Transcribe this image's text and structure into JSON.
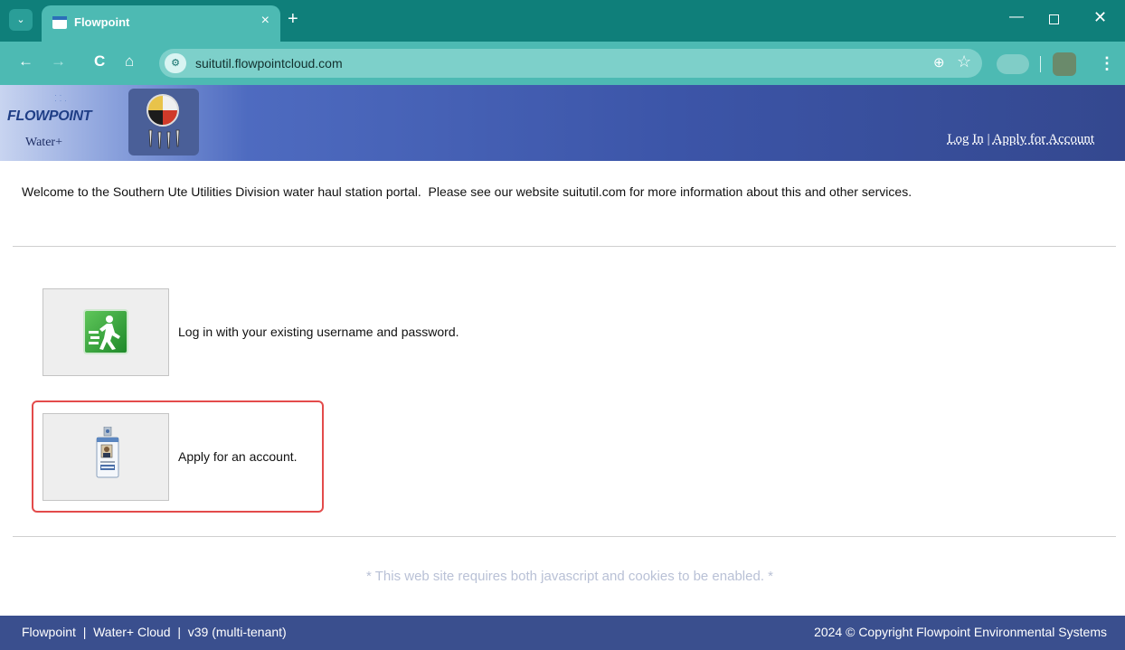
{
  "browser": {
    "tab_title": "Flowpoint",
    "tab_close": "×",
    "new_tab": "+",
    "url": "suitutil.flowpointcloud.com",
    "back": "←",
    "forward": "→",
    "reload": "C",
    "home": "⌂",
    "zoom": "⊕",
    "star": "☆",
    "menu": "⋮",
    "minimize": "—",
    "close": "✕"
  },
  "header": {
    "logo_text": "FLOWPOINT",
    "logo_sub": "Water+",
    "login_link": "Log In",
    "separator": "|",
    "apply_link": "Apply for Account"
  },
  "main": {
    "welcome": "Welcome to the Southern Ute Utilities Division water haul station portal.  Please see our website suitutil.com for more information about this and other services.",
    "options": [
      {
        "label": "Log in with your existing username and password.",
        "icon": "login-exit-icon"
      },
      {
        "label": "Apply for an account.",
        "icon": "id-badge-icon"
      }
    ],
    "notice": "* This web site requires both javascript and cookies to be enabled. *"
  },
  "footer": {
    "left": "Flowpoint  |  Water+ Cloud  |  v39 (multi-tenant)",
    "right": "2024 © Copyright Flowpoint Environmental Systems"
  },
  "colors": {
    "tab_bar": "#0f7f7a",
    "toolbar": "#4dbab3",
    "header": "#3c55a8",
    "footer": "#3a4f8e",
    "highlight": "#e34b4b"
  }
}
